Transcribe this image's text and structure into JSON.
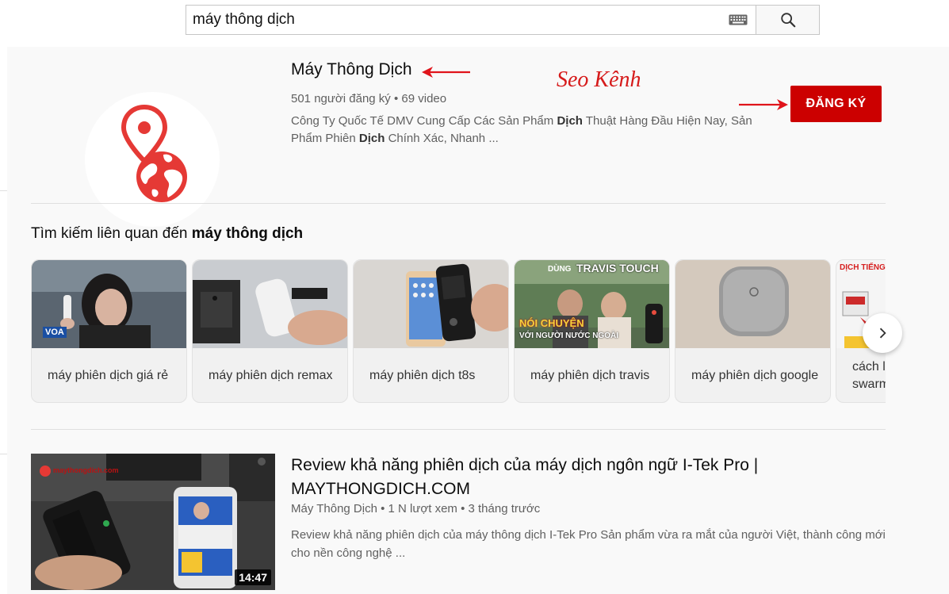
{
  "search": {
    "query": "máy thông dịch",
    "keyboard_icon": "keyboard-icon",
    "search_icon": "search-icon"
  },
  "channel": {
    "title": "Máy Thông Dịch",
    "annotation": "Seo Kênh",
    "meta": "501 người đăng ký • 69 video",
    "desc_line1_a": "Công Ty Quốc Tế DMV Cung Cấp Các Sản Phẩm ",
    "desc_line1_b": "Dịch",
    "desc_line1_c": " Thuật Hàng Đầu Hiện Nay, Sản",
    "desc_line2_a": "Phẩm Phiên ",
    "desc_line2_b": "Dịch",
    "desc_line2_c": " Chính Xác, Nhanh ...",
    "subscribe_label": "ĐĂNG KÝ",
    "brand_color": "#e53935",
    "subscribe_color": "#cc0000"
  },
  "related": {
    "title_prefix": "Tìm kiếm liên quan đến ",
    "title_query": "máy thông dịch",
    "cards": [
      {
        "label": "máy phiên dịch giá rẻ"
      },
      {
        "label": "máy phiên dịch remax"
      },
      {
        "label": "máy phiên dịch t8s"
      },
      {
        "label": "máy phiên dịch travis",
        "thumb_top": "TRAVIS TOUCH",
        "thumb_dung": "DÙNG",
        "thumb_mid": "NÓI CHUYỆN",
        "thumb_sub": "VỚI NGƯỜI NƯỚC NGOÀI"
      },
      {
        "label": "máy phiên dịch google"
      },
      {
        "label": "cách l swarm",
        "thumb_top": "DỊCH TIẾNG NGƯỜ"
      }
    ],
    "voa_badge": "VOA",
    "next_icon": "chevron-right-icon"
  },
  "video": {
    "title": "Review khả năng phiên dịch của máy dịch ngôn ngữ I-Tek Pro | MAYTHONGDICH.COM",
    "meta": "Máy Thông Dịch • 1 N lượt xem • 3 tháng trước",
    "desc": "Review khả năng phiên dịch của máy thông dịch I-Tek Pro Sản phẩm vừa ra mắt của người Việt, thành công mới cho nền công nghệ ...",
    "duration": "14:47",
    "thumb_brand": "maythongdich.com"
  }
}
